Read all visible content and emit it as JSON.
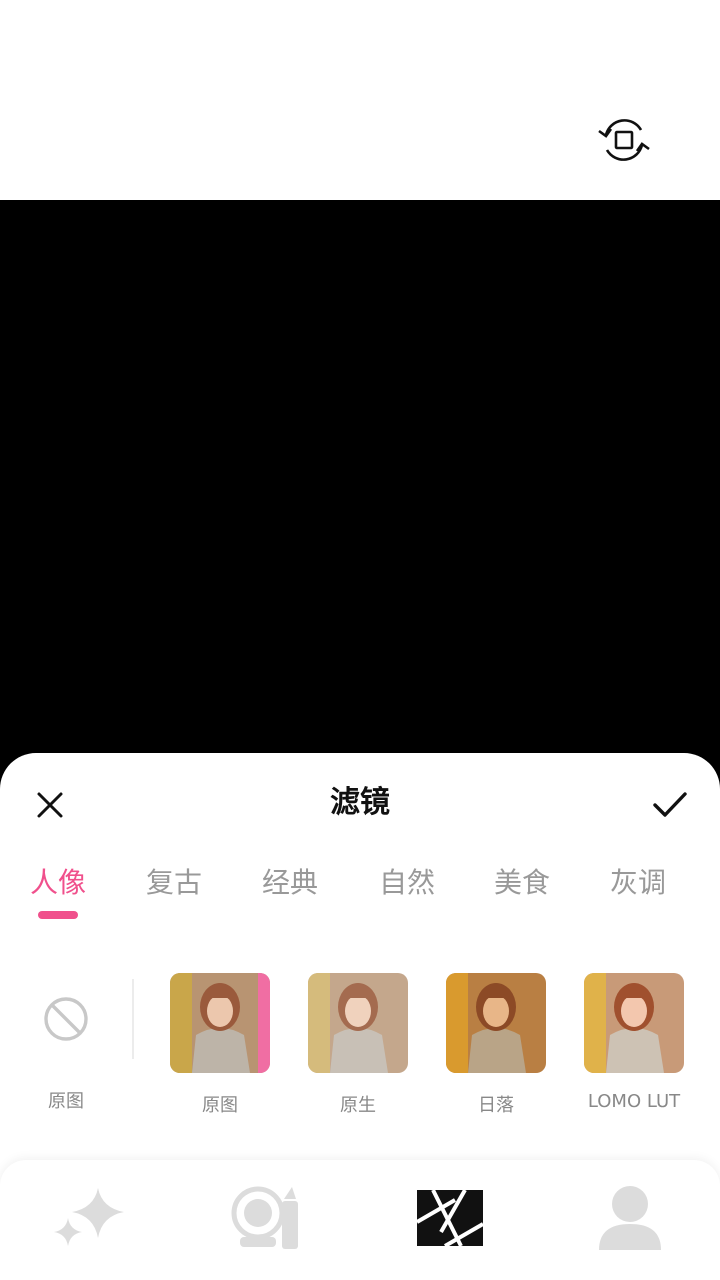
{
  "panel": {
    "title": "滤镜",
    "close_icon": "close-icon",
    "confirm_icon": "checkmark-icon"
  },
  "tabs": [
    {
      "label": "人像",
      "active": true
    },
    {
      "label": "复古",
      "active": false
    },
    {
      "label": "经典",
      "active": false
    },
    {
      "label": "自然",
      "active": false
    },
    {
      "label": "美食",
      "active": false
    },
    {
      "label": "灰调",
      "active": false
    }
  ],
  "original_option": {
    "label": "原图",
    "icon": "no-filter-icon"
  },
  "filters": [
    {
      "label": "原图"
    },
    {
      "label": "原生"
    },
    {
      "label": "日落"
    },
    {
      "label": "LOMO LUT"
    }
  ],
  "bottom_nav": [
    {
      "icon": "sparkles-icon"
    },
    {
      "icon": "makeup-icon"
    },
    {
      "icon": "filter-aperture-icon"
    },
    {
      "icon": "person-icon"
    }
  ],
  "colors": {
    "accent": "#f0508c",
    "inactive": "#999999",
    "preview": "#000000"
  }
}
